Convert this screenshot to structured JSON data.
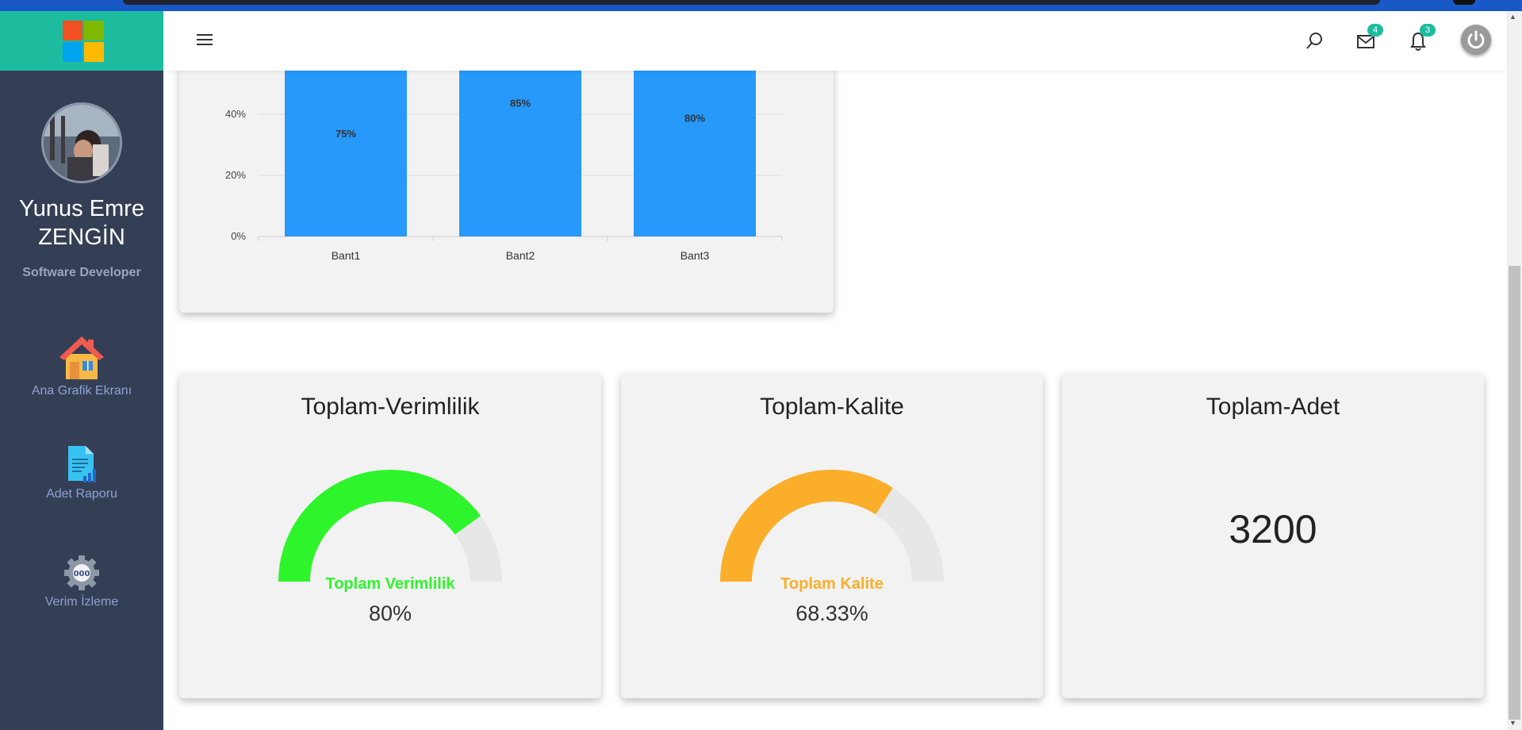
{
  "user": {
    "name_line1": "Yunus Emre",
    "name_line2": "ZENGİN",
    "role": "Software Developer"
  },
  "sidebar": {
    "items": [
      {
        "label": "Ana Grafik Ekranı",
        "icon": "house-icon"
      },
      {
        "label": "Adet Raporu",
        "icon": "report-document-icon"
      },
      {
        "label": "Verim İzleme",
        "icon": "gear-gauge-icon"
      }
    ]
  },
  "topbar": {
    "messages_count": "4",
    "notifications_count": "3"
  },
  "colors": {
    "sidebar_bg": "#343f56",
    "logo_bg": "#1ebc9f",
    "bar_blue": "#2699fb",
    "efficiency_green": "#2ef52b",
    "quality_orange": "#fbae2a",
    "gauge_track": "#e7e7e7"
  },
  "chart_data": {
    "type": "bar",
    "categories": [
      "Bant1",
      "Bant2",
      "Bant3"
    ],
    "values": [
      75,
      85,
      80
    ],
    "data_labels": [
      "75%",
      "85%",
      "80%"
    ],
    "y_ticks": [
      "0%",
      "20%",
      "40%"
    ],
    "ylim": [
      0,
      100
    ],
    "grid": true
  },
  "gauges": [
    {
      "title": "Toplam-Verimlilik",
      "label": "Toplam Verimlilik",
      "value": 80,
      "value_text": "80%",
      "color": "#2ef52b"
    },
    {
      "title": "Toplam-Kalite",
      "label": "Toplam Kalite",
      "value": 68.33,
      "value_text": "68.33%",
      "color": "#fbae2a"
    }
  ],
  "total": {
    "title": "Toplam-Adet",
    "value": "3200"
  }
}
